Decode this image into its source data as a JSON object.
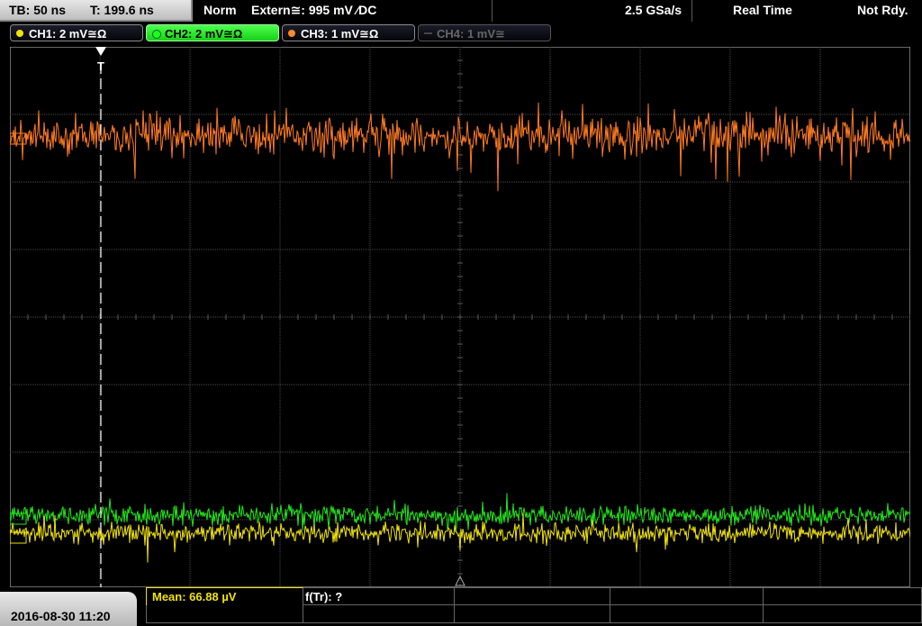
{
  "topbar": {
    "timebase": "TB: 50 ns",
    "trigger_time": "T: 199.6 ns",
    "trigger_mode": "Norm",
    "trigger_source": "Extern≅: 995 mV ∕DC",
    "sample_rate": "2.5 GSa/s",
    "acquisition_mode": "Real Time",
    "status": "Not Rdy."
  },
  "channels": [
    {
      "label": "CH1: 2 mV≅Ω",
      "color": "#f0e20a",
      "active": true
    },
    {
      "label": "CH2: 2 mV≅Ω",
      "color": "#1eff1e",
      "active": true
    },
    {
      "label": "CH3: 1 mV≅Ω",
      "color": "#ff8a2a",
      "active": true
    },
    {
      "label": "CH4: 1 mV≅",
      "color": "#666666",
      "active": false
    }
  ],
  "trigger_marker": "T",
  "measurement": {
    "mean": "Mean: 66.88 µV",
    "ftr": "f(Tr): ?"
  },
  "datetime": "2016-08-30 11:20",
  "colors": {
    "ch1": "#f0e20a",
    "ch2": "#22e61a",
    "ch3": "#ff7b22",
    "grid": "#4a4a4a",
    "accent_yellow": "#f0e20a"
  }
}
